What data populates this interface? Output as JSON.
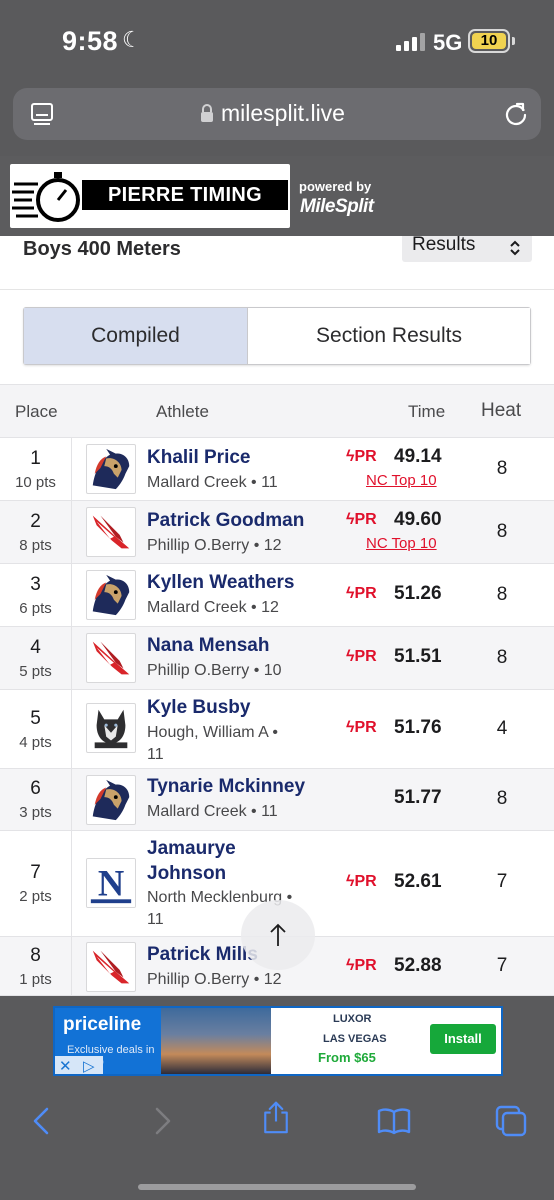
{
  "status_bar": {
    "time": "9:58",
    "network": "5G",
    "battery": "10"
  },
  "browser": {
    "url": "milesplit.live",
    "icons": [
      "reader-icon",
      "lock-icon",
      "reload-icon"
    ]
  },
  "header": {
    "logo_text": "PIERRE TIMING",
    "powered_by": "powered by",
    "partner": "MileSplit"
  },
  "event": {
    "title": "Boys 400 Meters",
    "view_select": "Results"
  },
  "tabs": [
    {
      "label": "Compiled",
      "active": true
    },
    {
      "label": "Section Results",
      "active": false
    }
  ],
  "table": {
    "headers": {
      "place": "Place",
      "athlete": "Athlete",
      "time": "Time",
      "heat": "Heat"
    },
    "rows": [
      {
        "place": "1",
        "pts": "10 pts",
        "name": "Khalil Price",
        "team": "Mallard Creek • 11",
        "pr": "PR",
        "time": "49.14",
        "badge": "NC Top 10",
        "heat": "8",
        "logo": "mustang-logo"
      },
      {
        "place": "2",
        "pts": "8 pts",
        "name": "Patrick Goodman",
        "team": "Phillip O.Berry • 12",
        "pr": "PR",
        "time": "49.60",
        "badge": "NC Top 10",
        "heat": "8",
        "logo": "cardinal-logo"
      },
      {
        "place": "3",
        "pts": "6 pts",
        "name": "Kyllen Weathers",
        "team": "Mallard Creek • 12",
        "pr": "PR",
        "time": "51.26",
        "badge": "",
        "heat": "8",
        "logo": "mustang-logo"
      },
      {
        "place": "4",
        "pts": "5 pts",
        "name": "Nana Mensah",
        "team": "Phillip O.Berry • 10",
        "pr": "PR",
        "time": "51.51",
        "badge": "",
        "heat": "8",
        "logo": "cardinal-logo"
      },
      {
        "place": "5",
        "pts": "4 pts",
        "name": "Kyle Busby",
        "team": "Hough, William A • 11",
        "pr": "PR",
        "time": "51.76",
        "badge": "",
        "heat": "4",
        "logo": "husky-logo"
      },
      {
        "place": "6",
        "pts": "3 pts",
        "name": "Tynarie Mckinney",
        "team": "Mallard Creek • 11",
        "pr": "",
        "time": "51.77",
        "badge": "",
        "heat": "8",
        "logo": "mustang-logo"
      },
      {
        "place": "7",
        "pts": "2 pts",
        "name": "Jamaurye Johnson",
        "team": "North Mecklenburg • 11",
        "pr": "PR",
        "time": "52.61",
        "badge": "",
        "heat": "7",
        "logo": "n-logo"
      },
      {
        "place": "8",
        "pts": "1 pts",
        "name": "Patrick Mills",
        "team": "Phillip O.Berry • 12",
        "pr": "PR",
        "time": "52.88",
        "badge": "",
        "heat": "7",
        "logo": "cardinal-logo"
      }
    ]
  },
  "ad": {
    "brand": "priceline",
    "subtext": "Exclusive deals in the app",
    "hotel": "LUXOR",
    "city": "LAS VEGAS",
    "price": "From $65",
    "cta": "Install"
  },
  "toolbar": {
    "icons": [
      "back-icon",
      "forward-icon",
      "share-icon",
      "bookmarks-icon",
      "tabs-icon"
    ]
  },
  "colors": {
    "accent_navy": "#1a2a6c",
    "pr_red": "#e0102b",
    "tab_active": "#d7deef",
    "chrome_gray": "#5a5a5c"
  }
}
